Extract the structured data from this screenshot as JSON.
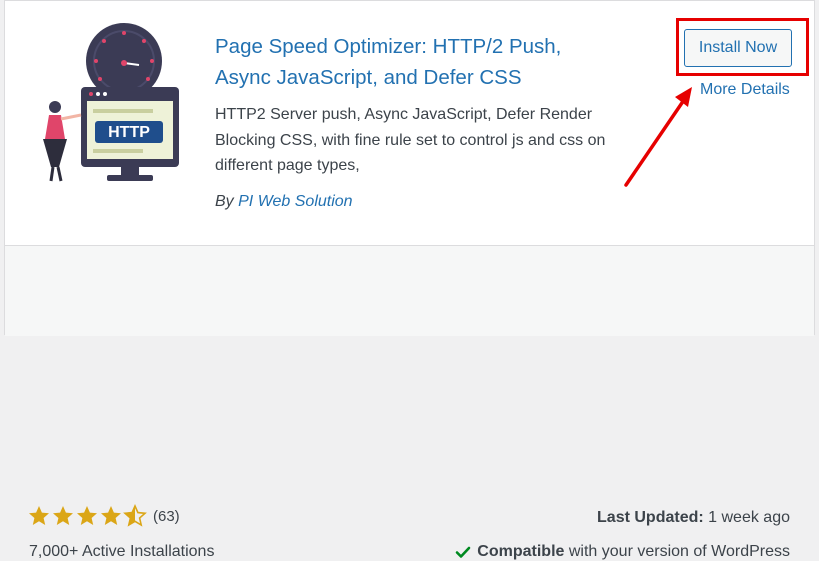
{
  "plugin": {
    "title": "Page Speed Optimizer: HTTP/2 Push, Async JavaScript, and Defer CSS",
    "description": "HTTP2 Server push, Async JavaScript, Defer Render Blocking CSS, with fine rule set to control js and css on different page types,",
    "author_prefix": "By",
    "author_name": "PI Web Solution",
    "icon_text": "HTTP",
    "icon": "http-speed-illustration-icon"
  },
  "actions": {
    "install_label": "Install Now",
    "more_details_label": "More Details"
  },
  "footer": {
    "rating_stars": 4.5,
    "rating_count": "(63)",
    "active_installs": "7,000+ Active Installations",
    "last_updated_label": "Last Updated:",
    "last_updated_value": "1 week ago",
    "compatible_label": "Compatible",
    "compatible_text": "with your version of WordPress"
  },
  "colors": {
    "link": "#2271b1",
    "star": "#dba617",
    "check": "#008a20",
    "annotation": "#e60000"
  }
}
